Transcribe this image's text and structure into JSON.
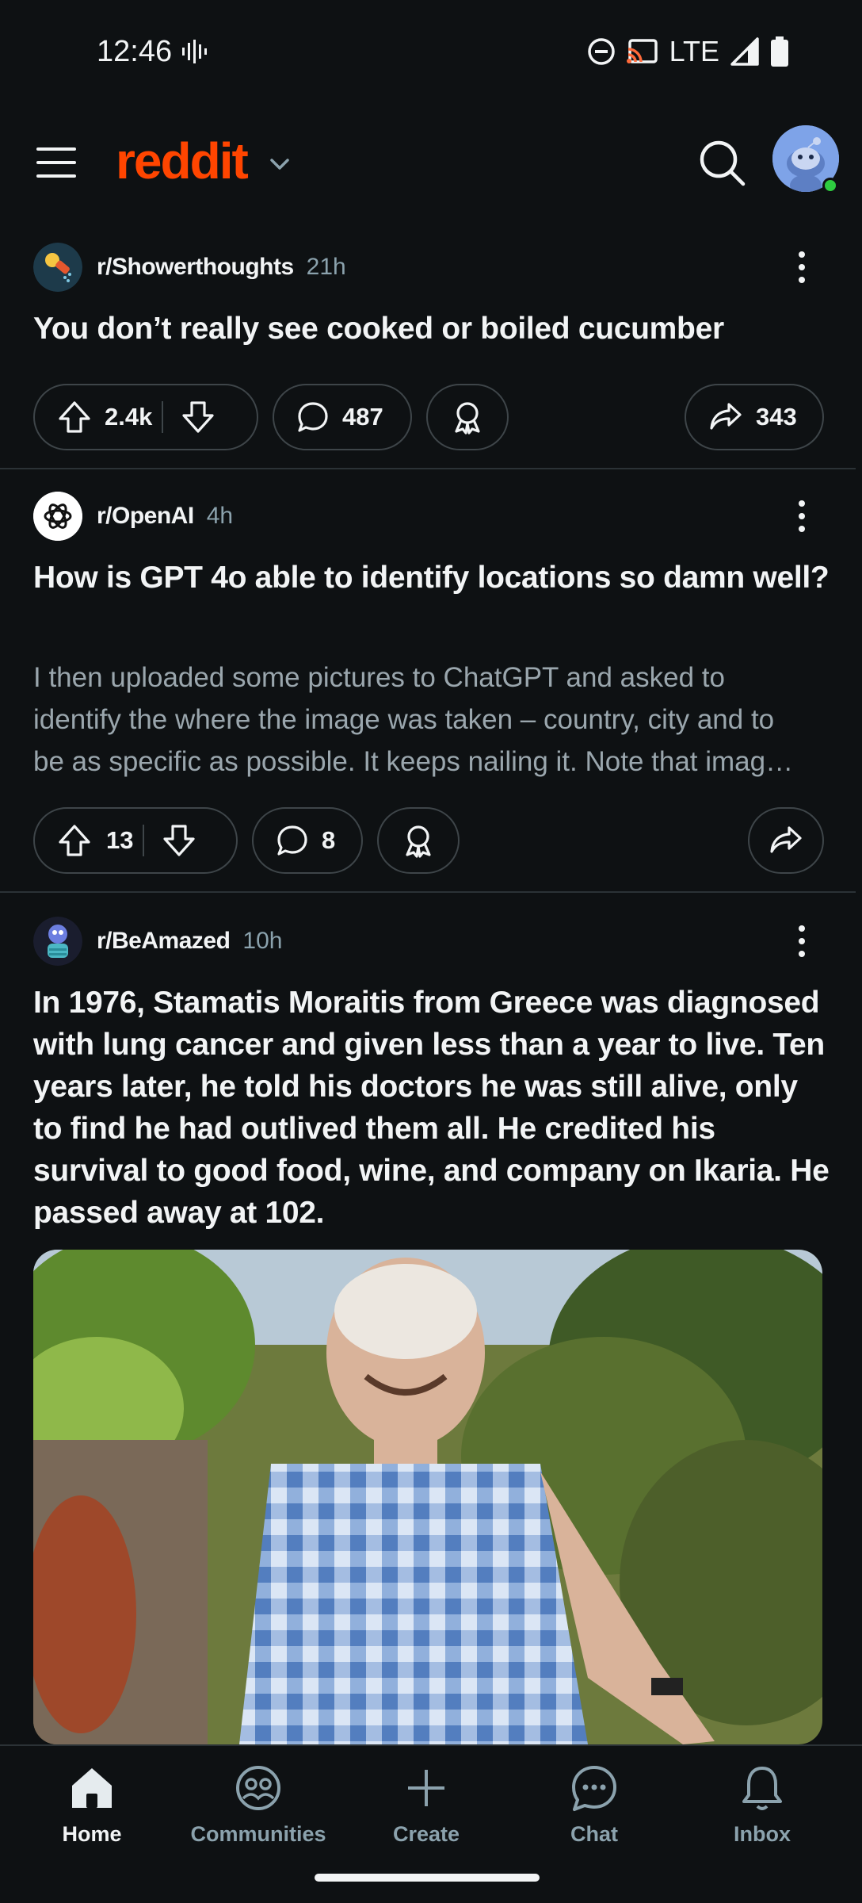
{
  "status_bar": {
    "time": "12:46",
    "network": "LTE"
  },
  "header": {
    "logo": "reddit"
  },
  "posts": [
    {
      "subreddit": "r/Showerthoughts",
      "age": "21h",
      "title": "You don’t really see cooked or boiled cucumber",
      "upvotes": "2.4k",
      "comments": "487",
      "shares": "343"
    },
    {
      "subreddit": "r/OpenAI",
      "age": "4h",
      "title": "How is GPT 4o able to identify locations so damn well?",
      "body_lines": [
        "I then uploaded some pictures to ChatGPT and asked to",
        "identify the where the image was taken – country, city and to",
        "be as specific as possible. It keeps nailing it. Note that imag…"
      ],
      "upvotes": "13",
      "comments": "8"
    },
    {
      "subreddit": "r/BeAmazed",
      "age": "10h",
      "title": "In 1976, Stamatis Moraitis from Greece was diagnosed with lung cancer and given less than a year to live. Ten years later, he told his doctors he was still alive, only to find he had outlived them all. He credited his survival to good food, wine, and company on Ikaria. He passed away at 102."
    }
  ],
  "bottom_nav": {
    "items": [
      {
        "label": "Home",
        "icon": "home-icon",
        "active": true
      },
      {
        "label": "Communities",
        "icon": "communities-icon"
      },
      {
        "label": "Create",
        "icon": "plus-icon"
      },
      {
        "label": "Chat",
        "icon": "chat-icon"
      },
      {
        "label": "Inbox",
        "icon": "bell-icon"
      }
    ]
  },
  "colors": {
    "background": "#0e1113",
    "brand": "#ff4500",
    "muted": "#8ba2ad",
    "online": "#2ecc40"
  }
}
